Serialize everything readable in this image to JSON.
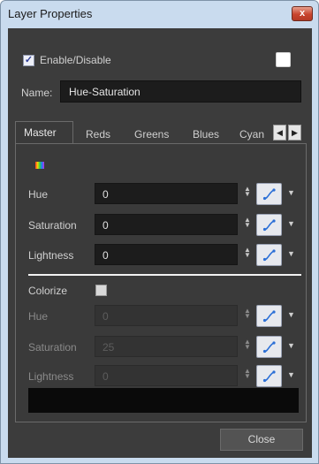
{
  "window": {
    "title": "Layer Properties",
    "close_glyph": "x"
  },
  "enable": {
    "label": "Enable/Disable",
    "checked": true,
    "color_swatch": "#ffffff"
  },
  "name": {
    "label": "Name:",
    "value": "Hue-Saturation"
  },
  "tabs": [
    {
      "label": "Master",
      "active": true
    },
    {
      "label": "Reds"
    },
    {
      "label": "Greens"
    },
    {
      "label": "Blues"
    },
    {
      "label": "Cyan"
    }
  ],
  "master": {
    "rows": [
      {
        "label": "Hue",
        "value": "0"
      },
      {
        "label": "Saturation",
        "value": "0"
      },
      {
        "label": "Lightness",
        "value": "0"
      }
    ]
  },
  "colorize": {
    "label": "Colorize",
    "checked": false,
    "rows": [
      {
        "label": "Hue",
        "value": "0"
      },
      {
        "label": "Saturation",
        "value": "25"
      },
      {
        "label": "Lightness",
        "value": "0"
      }
    ]
  },
  "buttons": {
    "close": "Close"
  },
  "icons": {
    "function_curve": "function-curve-icon",
    "spinner": "spinner-arrows-icon",
    "dropdown": "chevron-down-icon",
    "tab_left": "scroll-left-icon",
    "tab_right": "scroll-right-icon",
    "color_mode": "color-spectrum-icon"
  },
  "colors": {
    "panel_bg": "#3a3a3a",
    "field_bg": "#1c1c1c",
    "title_bar": "#c9dbee",
    "close_red": "#c8452e"
  }
}
